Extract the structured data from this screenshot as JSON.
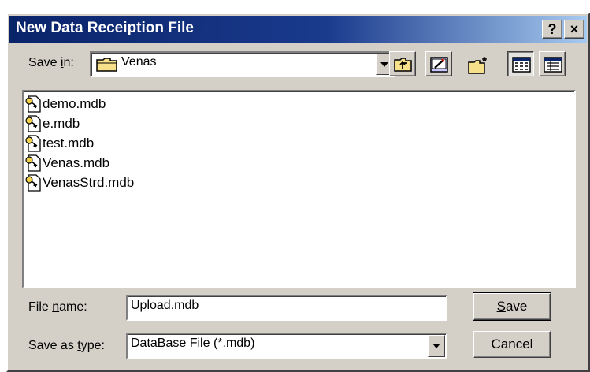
{
  "window": {
    "title": "New Data Receiption File",
    "help_label": "?",
    "close_label": "×"
  },
  "save_in": {
    "label_pre": "Save ",
    "label_access": "i",
    "label_post": "n:",
    "value": "Venas",
    "icon": "folder-icon"
  },
  "toolbar": {
    "buttons": [
      "up-one-level-icon",
      "create-new-folder-icon",
      "new-folder-icon",
      "list-view-icon",
      "details-view-icon"
    ]
  },
  "files": [
    {
      "name": "demo.mdb",
      "icon": "access-db-file-icon"
    },
    {
      "name": "e.mdb",
      "icon": "access-db-file-icon"
    },
    {
      "name": "test.mdb",
      "icon": "access-db-file-icon"
    },
    {
      "name": "Venas.mdb",
      "icon": "access-db-file-icon"
    },
    {
      "name": "VenasStrd.mdb",
      "icon": "access-db-file-icon"
    }
  ],
  "file_name": {
    "label_pre": "File ",
    "label_access": "n",
    "label_post": "ame:",
    "value": "Upload.mdb"
  },
  "save_as_type": {
    "label_pre": "Save as ",
    "label_access": "t",
    "label_post": "ype:",
    "value": "DataBase File (*.mdb)"
  },
  "buttons": {
    "save_access": "S",
    "save_rest": "ave",
    "cancel": "Cancel"
  },
  "colors": {
    "title_gradient_start": "#0a246a",
    "title_gradient_end": "#a6caf0",
    "face": "#d4d0c8"
  }
}
